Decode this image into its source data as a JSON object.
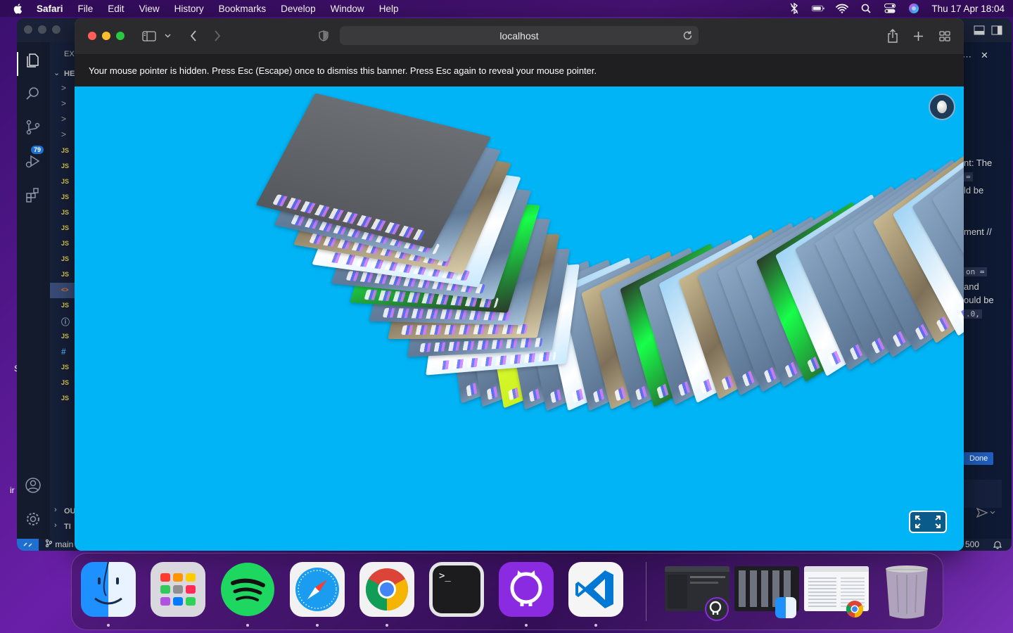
{
  "menubar": {
    "app_name": "Safari",
    "items": [
      "File",
      "Edit",
      "View",
      "History",
      "Bookmarks",
      "Develop",
      "Window",
      "Help"
    ],
    "clock": "Thu 17 Apr  18:04"
  },
  "vscode": {
    "explorer_header": "EX",
    "section_header": "HE",
    "source_control_badge": "79",
    "file_rows": [
      {
        "icon": ">",
        "kind": "folder"
      },
      {
        "icon": ">",
        "kind": "folder"
      },
      {
        "icon": ">",
        "kind": "folder"
      },
      {
        "icon": ">",
        "kind": "folder"
      },
      {
        "icon": "JS",
        "kind": "js"
      },
      {
        "icon": "JS",
        "kind": "js"
      },
      {
        "icon": "JS",
        "kind": "js"
      },
      {
        "icon": "JS",
        "kind": "js"
      },
      {
        "icon": "JS",
        "kind": "js"
      },
      {
        "icon": "JS",
        "kind": "js"
      },
      {
        "icon": "JS",
        "kind": "js"
      },
      {
        "icon": "JS",
        "kind": "js"
      },
      {
        "icon": "JS",
        "kind": "js"
      },
      {
        "icon": "<>",
        "kind": "html"
      },
      {
        "icon": "JS",
        "kind": "js"
      },
      {
        "icon": "ⓘ",
        "kind": "info"
      },
      {
        "icon": "JS",
        "kind": "js"
      },
      {
        "icon": "#",
        "kind": "css"
      },
      {
        "icon": "JS",
        "kind": "js"
      },
      {
        "icon": "JS",
        "kind": "js"
      },
      {
        "icon": "JS",
        "kind": "js"
      }
    ],
    "outline_label": "OU",
    "timeline_label": "TI",
    "branch": "main",
    "status_right": "500",
    "chat_fragments": {
      "line1": "nt: The",
      "line2": "=",
      "line3": "ld be",
      "line4": "ment //",
      "line5": "on =",
      "line6": "and",
      "line7": "ould be",
      "line8": ".0,"
    },
    "done_label": "Done"
  },
  "safari": {
    "url": "localhost",
    "banner": "Your mouse pointer is hidden. Press Esc (Escape) once to dismiss this banner. Press Esc again to reveal your mouse pointer."
  },
  "dock": {
    "apps": [
      "Finder",
      "Launchpad",
      "Spotify",
      "Safari",
      "Google Chrome",
      "Terminal",
      "GitHub Desktop",
      "Visual Studio Code"
    ],
    "recent_windows": [
      "GitHub Desktop window",
      "Finder window",
      "Chrome window"
    ],
    "trash": "Trash"
  },
  "left_fragments": {
    "a": "S",
    "b": "ir"
  },
  "colors": {
    "page_blue": "#00b4f5",
    "banner_bg": "#1f1f21",
    "vscode_accent": "#1f6fd1"
  }
}
